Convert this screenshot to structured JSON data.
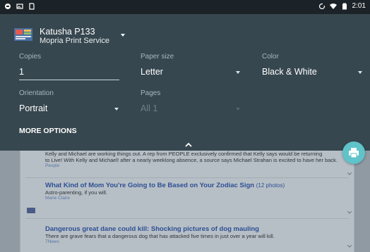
{
  "status_bar": {
    "time": "2:01",
    "left_icons": [
      "app-notification-icon",
      "photo-icon",
      "sd-card-icon"
    ],
    "right_icons": [
      "sync-icon",
      "wifi-icon",
      "battery-icon"
    ]
  },
  "printer": {
    "name": "Katusha P133",
    "service": "Mopria Print Service"
  },
  "fields": {
    "copies": {
      "label": "Copies",
      "value": "1"
    },
    "paper_size": {
      "label": "Paper size",
      "value": "Letter"
    },
    "color": {
      "label": "Color",
      "value": "Black & White"
    },
    "orientation": {
      "label": "Orientation",
      "value": "Portrait"
    },
    "pages": {
      "label": "Pages",
      "value": "All 1"
    }
  },
  "more_options": "MORE OPTIONS",
  "fab_icon": "print-icon",
  "page_preview": {
    "story1": {
      "desc_line1": "Kelly and Michael are working things out. A rep from PEOPLE exclusively confirmed that Kelly says would be returning",
      "desc_line2": "to Live! With Kelly and Michael! after a nearly weeklong absence, a source says Michael Strahan is excited to have her back.",
      "source": "People"
    },
    "story2": {
      "title": "What Kind of Mom You're Going to Be Based on Your Zodiac Sign",
      "photos": "(12 photos)",
      "desc": "Astro-parenting, if you will.",
      "source": "Marie Claire"
    },
    "story3": {
      "title": "Dangerous great dane could kill: Shocking pictures of dog mauling",
      "desc": "There are grave fears that a dangerous dog that has attacked five times in just over a year will kill.",
      "source": "7News"
    }
  },
  "colors": {
    "panel": "#37474f",
    "fab": "#5fc3c9",
    "status_bar": "#1c2328",
    "link": "#2d4f93"
  }
}
